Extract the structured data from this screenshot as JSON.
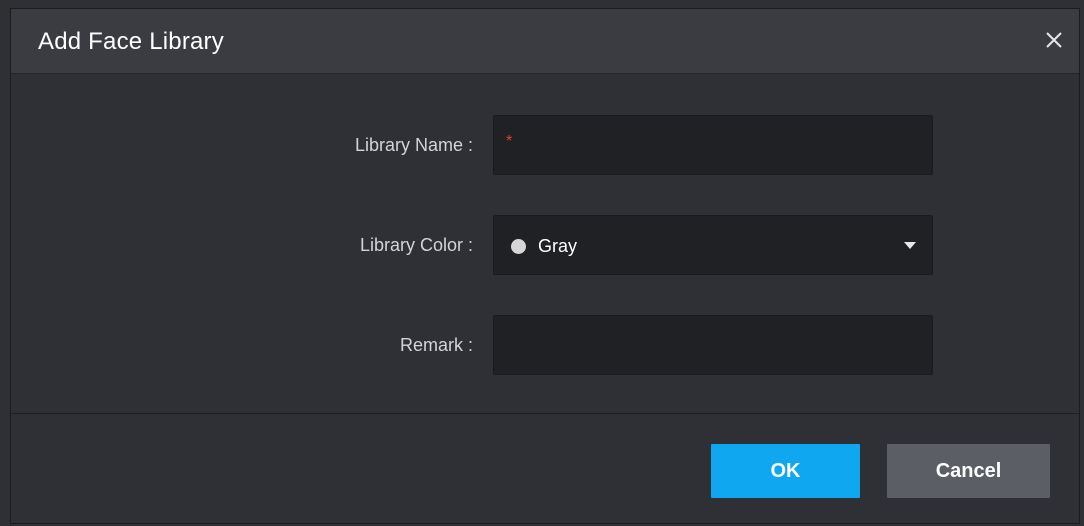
{
  "dialog": {
    "title": "Add Face Library",
    "close_icon": "close-icon"
  },
  "form": {
    "library_name": {
      "label": "Library Name :",
      "value": "",
      "required_marker": "*"
    },
    "library_color": {
      "label": "Library Color :",
      "selected": "Gray",
      "swatch_color": "#d6d6d6"
    },
    "remark": {
      "label": "Remark :",
      "value": ""
    }
  },
  "buttons": {
    "ok_label": "OK",
    "cancel_label": "Cancel"
  },
  "colors": {
    "accent": "#0fa7ef",
    "required": "#e0412f",
    "background": "#2e3035",
    "input_bg": "#202125"
  }
}
